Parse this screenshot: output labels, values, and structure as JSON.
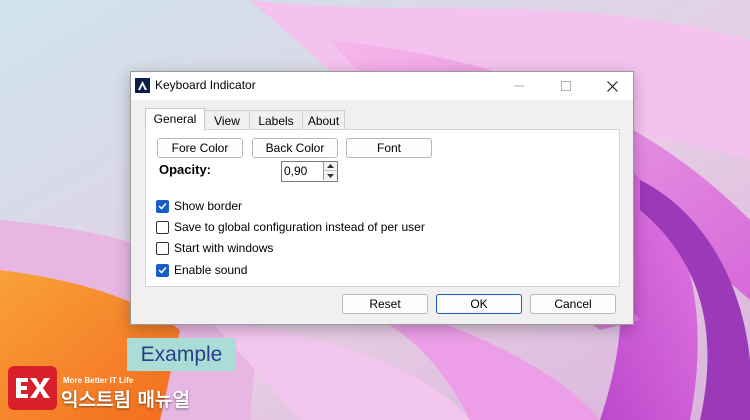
{
  "window": {
    "title": "Keyboard Indicator",
    "controls": [
      "minimize",
      "maximize",
      "close"
    ]
  },
  "tabs": [
    {
      "label": "General",
      "active": true
    },
    {
      "label": "View",
      "active": false
    },
    {
      "label": "Labels",
      "active": false
    },
    {
      "label": "About",
      "active": false
    }
  ],
  "general": {
    "color_buttons": {
      "fore": "Fore Color",
      "back": "Back Color",
      "font": "Font"
    },
    "opacity": {
      "label": "Opacity:",
      "value": "0,90"
    },
    "options": [
      {
        "label": "Show border",
        "checked": true
      },
      {
        "label": "Save to global configuration instead of per user",
        "checked": false
      },
      {
        "label": "Start with windows",
        "checked": false
      },
      {
        "label": "Enable sound",
        "checked": true
      }
    ]
  },
  "footer_buttons": {
    "reset": "Reset",
    "ok": "OK",
    "cancel": "Cancel"
  },
  "caption": {
    "label": "Example"
  },
  "branding": {
    "logo_text": "EX",
    "tagline": "More Better IT Life",
    "name": "익스트림 매뉴얼"
  },
  "colors": {
    "accent": "#1a5dc8",
    "logo_red": "#d81f2a",
    "caption_bg": "#a9ddd5"
  }
}
